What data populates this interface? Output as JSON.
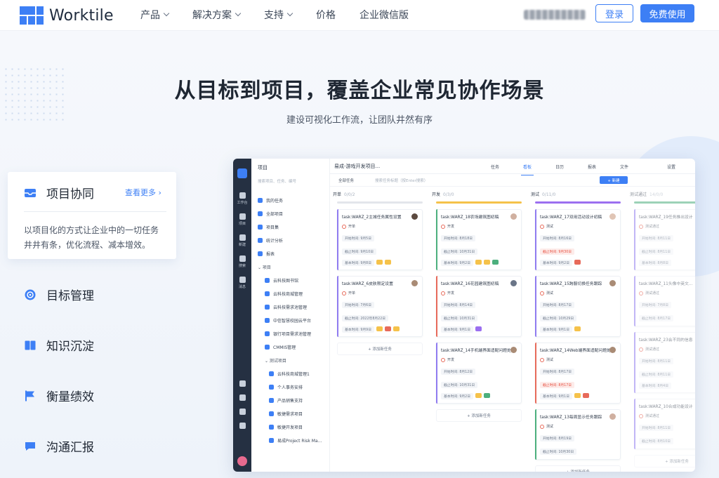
{
  "header": {
    "brand": "Worktile",
    "nav": [
      {
        "label": "产品",
        "dropdown": true
      },
      {
        "label": "解决方案",
        "dropdown": true
      },
      {
        "label": "支持",
        "dropdown": true
      },
      {
        "label": "价格",
        "dropdown": false
      },
      {
        "label": "企业微信版",
        "dropdown": false
      }
    ],
    "login_label": "登录",
    "free_label": "免费使用"
  },
  "hero": {
    "title": "从目标到项目，覆盖企业常见协作场景",
    "subtitle": "建设可视化工作流，让团队井然有序"
  },
  "features": {
    "active": {
      "label": "项目协同",
      "more": "查看更多 ›",
      "desc": "以项目化的方式让企业中的一切任务井井有条，优化流程、减本增效。"
    },
    "items": [
      {
        "label": "目标管理",
        "icon": "target-icon"
      },
      {
        "label": "知识沉淀",
        "icon": "book-icon"
      },
      {
        "label": "衡量绩效",
        "icon": "flag-icon"
      },
      {
        "label": "沟通汇报",
        "icon": "chat-icon"
      }
    ]
  },
  "app": {
    "rail": [
      "工作台",
      "项目",
      "新建",
      "搜索",
      "消息"
    ],
    "side": {
      "title": "项目",
      "search_placeholder": "搜索项目、任务、编号",
      "items": [
        "我的任务",
        "全部项目",
        "项目集",
        "统计分析",
        "报表"
      ],
      "group": "项目",
      "projects": [
        "云科技图书馆",
        "云科技商城管理",
        "云科技需求池管理",
        "中信智慧校园云平台",
        "银行项目需求池管理",
        "CMMIS管理"
      ],
      "subgroup": "测试项目",
      "subprojects": [
        "云科技商城管理1",
        "个人事务安排",
        "产品销售支持",
        "敏捷需求项目",
        "敏捷开发项目",
        "易成Project Risk Ma..."
      ]
    },
    "topbar": {
      "project": "易成-游戏开发项目...",
      "tabs": [
        "任务",
        "看板",
        "日历",
        "报表",
        "文件"
      ],
      "active_tab": "看板",
      "settings": "设置"
    },
    "toolbar": {
      "filter": "全部任务",
      "search_placeholder": "搜索任务标题（按Enter搜索）",
      "new": "+ 新建"
    },
    "columns": [
      {
        "name": "开单",
        "count": "0/0/2",
        "color": "#e3e6eb",
        "cards": [
          {
            "title": "task:WARZ_2主城任务属性设置",
            "status": "开单",
            "start": "开始时间: 9月5日",
            "due": "截止时间: 9月10日",
            "plan": "基本时间: 9月8日",
            "due_red": false,
            "acc": "#8f7bf0",
            "tags": [
              "#f5c24a",
              "#f5c24a"
            ],
            "av": "#5c4a3f"
          },
          {
            "title": "task:WARZ_6皮肤限定设置",
            "status": "开单",
            "start": "开始时间: 7月6日",
            "due": "截止时间: 2022年8月22日",
            "plan": "基本时间: 9月9日",
            "due_red": false,
            "acc": "#8f7bf0",
            "tags": [
              "#f5c24a",
              "#e76a5a",
              "#f5c24a"
            ],
            "av": "#a98b75"
          }
        ],
        "add": "添加新任务"
      },
      {
        "name": "开发",
        "count": "0/3/0",
        "color": "#f5c24a",
        "cards": [
          {
            "title": "task:WARZ_18农场建筑图初稿",
            "status": "开发",
            "start": "开始时间: 8月18日",
            "due": "截止时间: 10月31日",
            "plan": "基本时间: 9月2日",
            "due_red": false,
            "acc": "#4caf7d",
            "tags": [
              "#f5c24a",
              "#f5c24a",
              "#4caf7d"
            ],
            "av": "#d0b0a0"
          },
          {
            "title": "task:WARZ_16花园建筑图初稿",
            "status": "开发",
            "start": "开始时间: 8月14日",
            "due": "截止时间: 10月31日",
            "plan": "基本时间: 9月1日",
            "due_red": false,
            "acc": "#e76a5a",
            "tags": [
              "#9b6ff0"
            ],
            "av": "#6a7587"
          },
          {
            "title": "task:WARZ_14手机端界面适配问题处理",
            "status": "开发",
            "start": "开始时间: 8月12日",
            "due": "截止时间: 10月31日",
            "plan": "基本时间: 9月2日",
            "due_red": false,
            "acc": "#8f7bf0",
            "tags": [
              "#f5c24a",
              "#4caf7d"
            ],
            "av": "#a98b75"
          }
        ],
        "add": "添加新任务"
      },
      {
        "name": "测试",
        "count": "0/11/0",
        "color": "#9b6ff0",
        "cards": [
          {
            "title": "task:WARZ_17双用活动设计初稿",
            "status": "测试",
            "start": "开始时间: 8月16日",
            "due": "截止时间: 9月30日",
            "plan": "基本时间: 9月2日",
            "due_red": true,
            "acc": "#8f7bf0",
            "tags": [
              "#e76a5a"
            ],
            "av": "#e0c5b5"
          },
          {
            "title": "task:WARZ_15跨服切换任务跟踪",
            "status": "测试",
            "start": "开始时间: 8月17日",
            "due": "截止时间: 10月29日",
            "plan": "基本时间: 9月1日",
            "due_red": false,
            "acc": "#8f7bf0",
            "tags": [
              "#f5c24a"
            ],
            "av": "#a98b75"
          },
          {
            "title": "task:WARZ_14Web端界面适配问题处理",
            "status": "测试",
            "start": "开始时间: 8月17日",
            "due": "截止时间: 8月17日",
            "plan": "基本时间: 9月1日",
            "due_red": true,
            "acc": "#e76a5a",
            "tags": [
              "#f5c24a",
              "#e76a5a"
            ],
            "av": "#a98b75"
          },
          {
            "title": "task:WARZ_13每周显示任务跟踪",
            "status": "测试",
            "start": "开始时间: 8月19日",
            "due": "截止时间: 10月30日",
            "plan": "",
            "due_red": false,
            "acc": "#4caf7d",
            "tags": [],
            "av": "#d0b0a0"
          }
        ],
        "add": "添加新任务"
      },
      {
        "name": "测试通过",
        "count": "14/0/0",
        "color": "#4caf7d",
        "cards": [
          {
            "title": "task:WARZ_19任务推出设计",
            "status": "测试通过",
            "start": "开始时间: 8月11日",
            "due": "截止时间: 8月11日",
            "plan": "基本时间: 8月8日",
            "due_red": false,
            "acc": "#8f7bf0",
            "tags": [],
            "av": ""
          },
          {
            "title": "task:WARZ_11头像中英文...",
            "status": "测试通过",
            "start": "开始时间: 7月8日",
            "due": "截止时间: 8月17日",
            "plan": "",
            "due_red": false,
            "acc": "#8f7bf0",
            "tags": [],
            "av": ""
          },
          {
            "title": "task:WARZ_23会不同的信息",
            "status": "测试通过",
            "start": "开始时间: 8月11日",
            "due": "截止时间: 8月11日",
            "plan": "基本时间: 8月4日",
            "due_red": false,
            "acc": "#8f7bf0",
            "tags": [],
            "av": ""
          },
          {
            "title": "task:WARZ_10合成功能设计",
            "status": "测试通过",
            "start": "开始时间: 8月11日",
            "due": "截止时间: 8月10日",
            "plan": "",
            "due_red": false,
            "acc": "#8f7bf0",
            "tags": [],
            "av": ""
          }
        ],
        "add": "添加新任务"
      }
    ]
  }
}
